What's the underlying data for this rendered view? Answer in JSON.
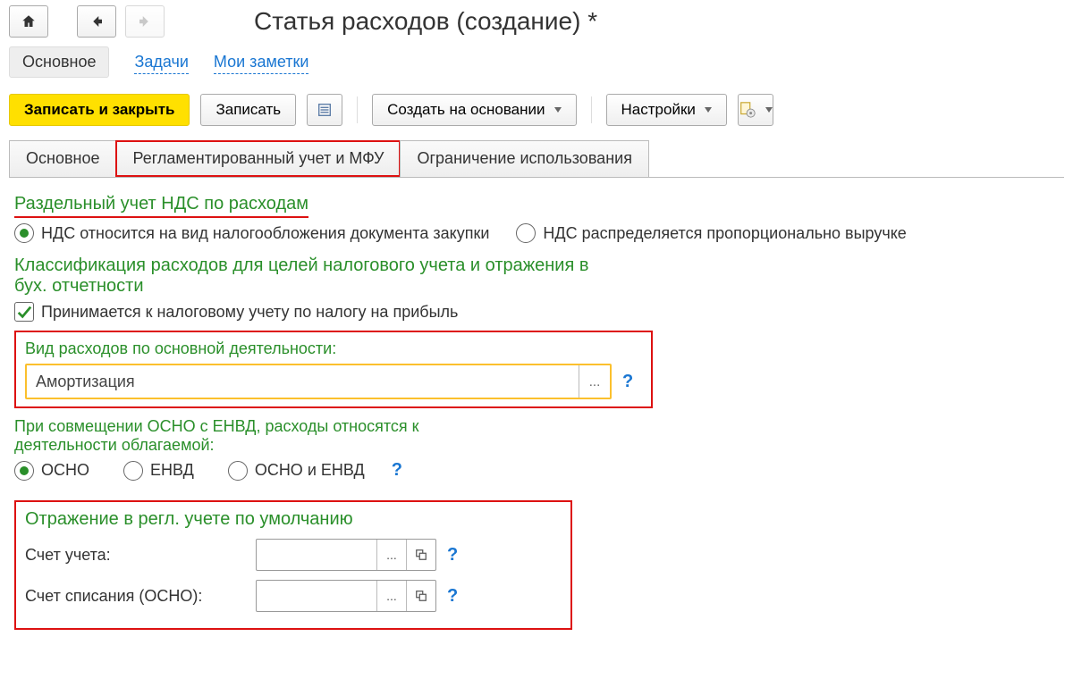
{
  "header": {
    "title": "Статья расходов (создание) *"
  },
  "navlinks": {
    "active": "Основное",
    "tasks": "Задачи",
    "notes": "Мои заметки"
  },
  "toolbar": {
    "save_close": "Записать и закрыть",
    "save": "Записать",
    "create_based": "Создать на основании",
    "settings": "Настройки"
  },
  "tabs": {
    "t1": "Основное",
    "t2": "Регламентированный учет и МФУ",
    "t3": "Ограничение использования"
  },
  "vat": {
    "title": "Раздельный учет НДС по расходам",
    "opt1": "НДС относится на вид налогообложения документа закупки",
    "opt2": "НДС распределяется пропорционально выручке"
  },
  "tax_class": {
    "title": "Классификация расходов для целей налогового учета и отражения в бух. отчетности",
    "check": "Принимается к налоговому учету по налогу на прибыль"
  },
  "activity": {
    "label": "Вид расходов по основной деятельности:",
    "value": "Амортизация"
  },
  "osno": {
    "label": "При совмещении ОСНО с ЕНВД, расходы относятся к деятельности облагаемой:",
    "o1": "ОСНО",
    "o2": "ЕНВД",
    "o3": "ОСНО и ЕНВД"
  },
  "regl": {
    "title": "Отражение в регл. учете по умолчанию",
    "acct": "Счет учета:",
    "writeoff": "Счет списания (ОСНО):"
  }
}
